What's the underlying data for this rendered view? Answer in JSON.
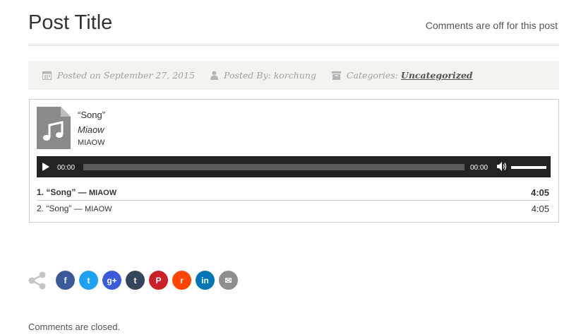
{
  "post": {
    "title": "Post Title",
    "comments_status": "Comments are off for this post"
  },
  "meta": {
    "posted_on": "Posted on September 27, 2015",
    "posted_by": "Posted By: korchung",
    "categories_label": "Categories:",
    "category": "Uncategorized"
  },
  "playlist": {
    "current": {
      "title": "“Song”",
      "album": "Miaow",
      "artist": "MIAOW"
    },
    "player": {
      "current_time": "00:00",
      "duration": "00:00",
      "progress_fraction": 0,
      "volume_fraction": 0.8
    },
    "tracks": [
      {
        "label": "1. “Song”",
        "separator": " — ",
        "artist": "MIAOW",
        "duration": "4:05"
      },
      {
        "label": "2. “Song”",
        "separator": " — ",
        "artist": "MIAOW",
        "duration": "4:05"
      }
    ]
  },
  "share": {
    "buttons": [
      {
        "name": "facebook",
        "glyph": "f",
        "color": "#3b5998"
      },
      {
        "name": "twitter",
        "glyph": "t",
        "color": "#1da1f2"
      },
      {
        "name": "google-plus",
        "glyph": "g+",
        "color": "#3b5bdb"
      },
      {
        "name": "tumblr",
        "glyph": "t",
        "color": "#35465c"
      },
      {
        "name": "pinterest",
        "glyph": "P",
        "color": "#cb2027"
      },
      {
        "name": "reddit",
        "glyph": "r",
        "color": "#ff4500"
      },
      {
        "name": "linkedin",
        "glyph": "in",
        "color": "#0077b5"
      },
      {
        "name": "email",
        "glyph": "✉",
        "color": "#8e8e8e"
      }
    ]
  },
  "footer": {
    "comments_closed": "Comments are closed."
  }
}
